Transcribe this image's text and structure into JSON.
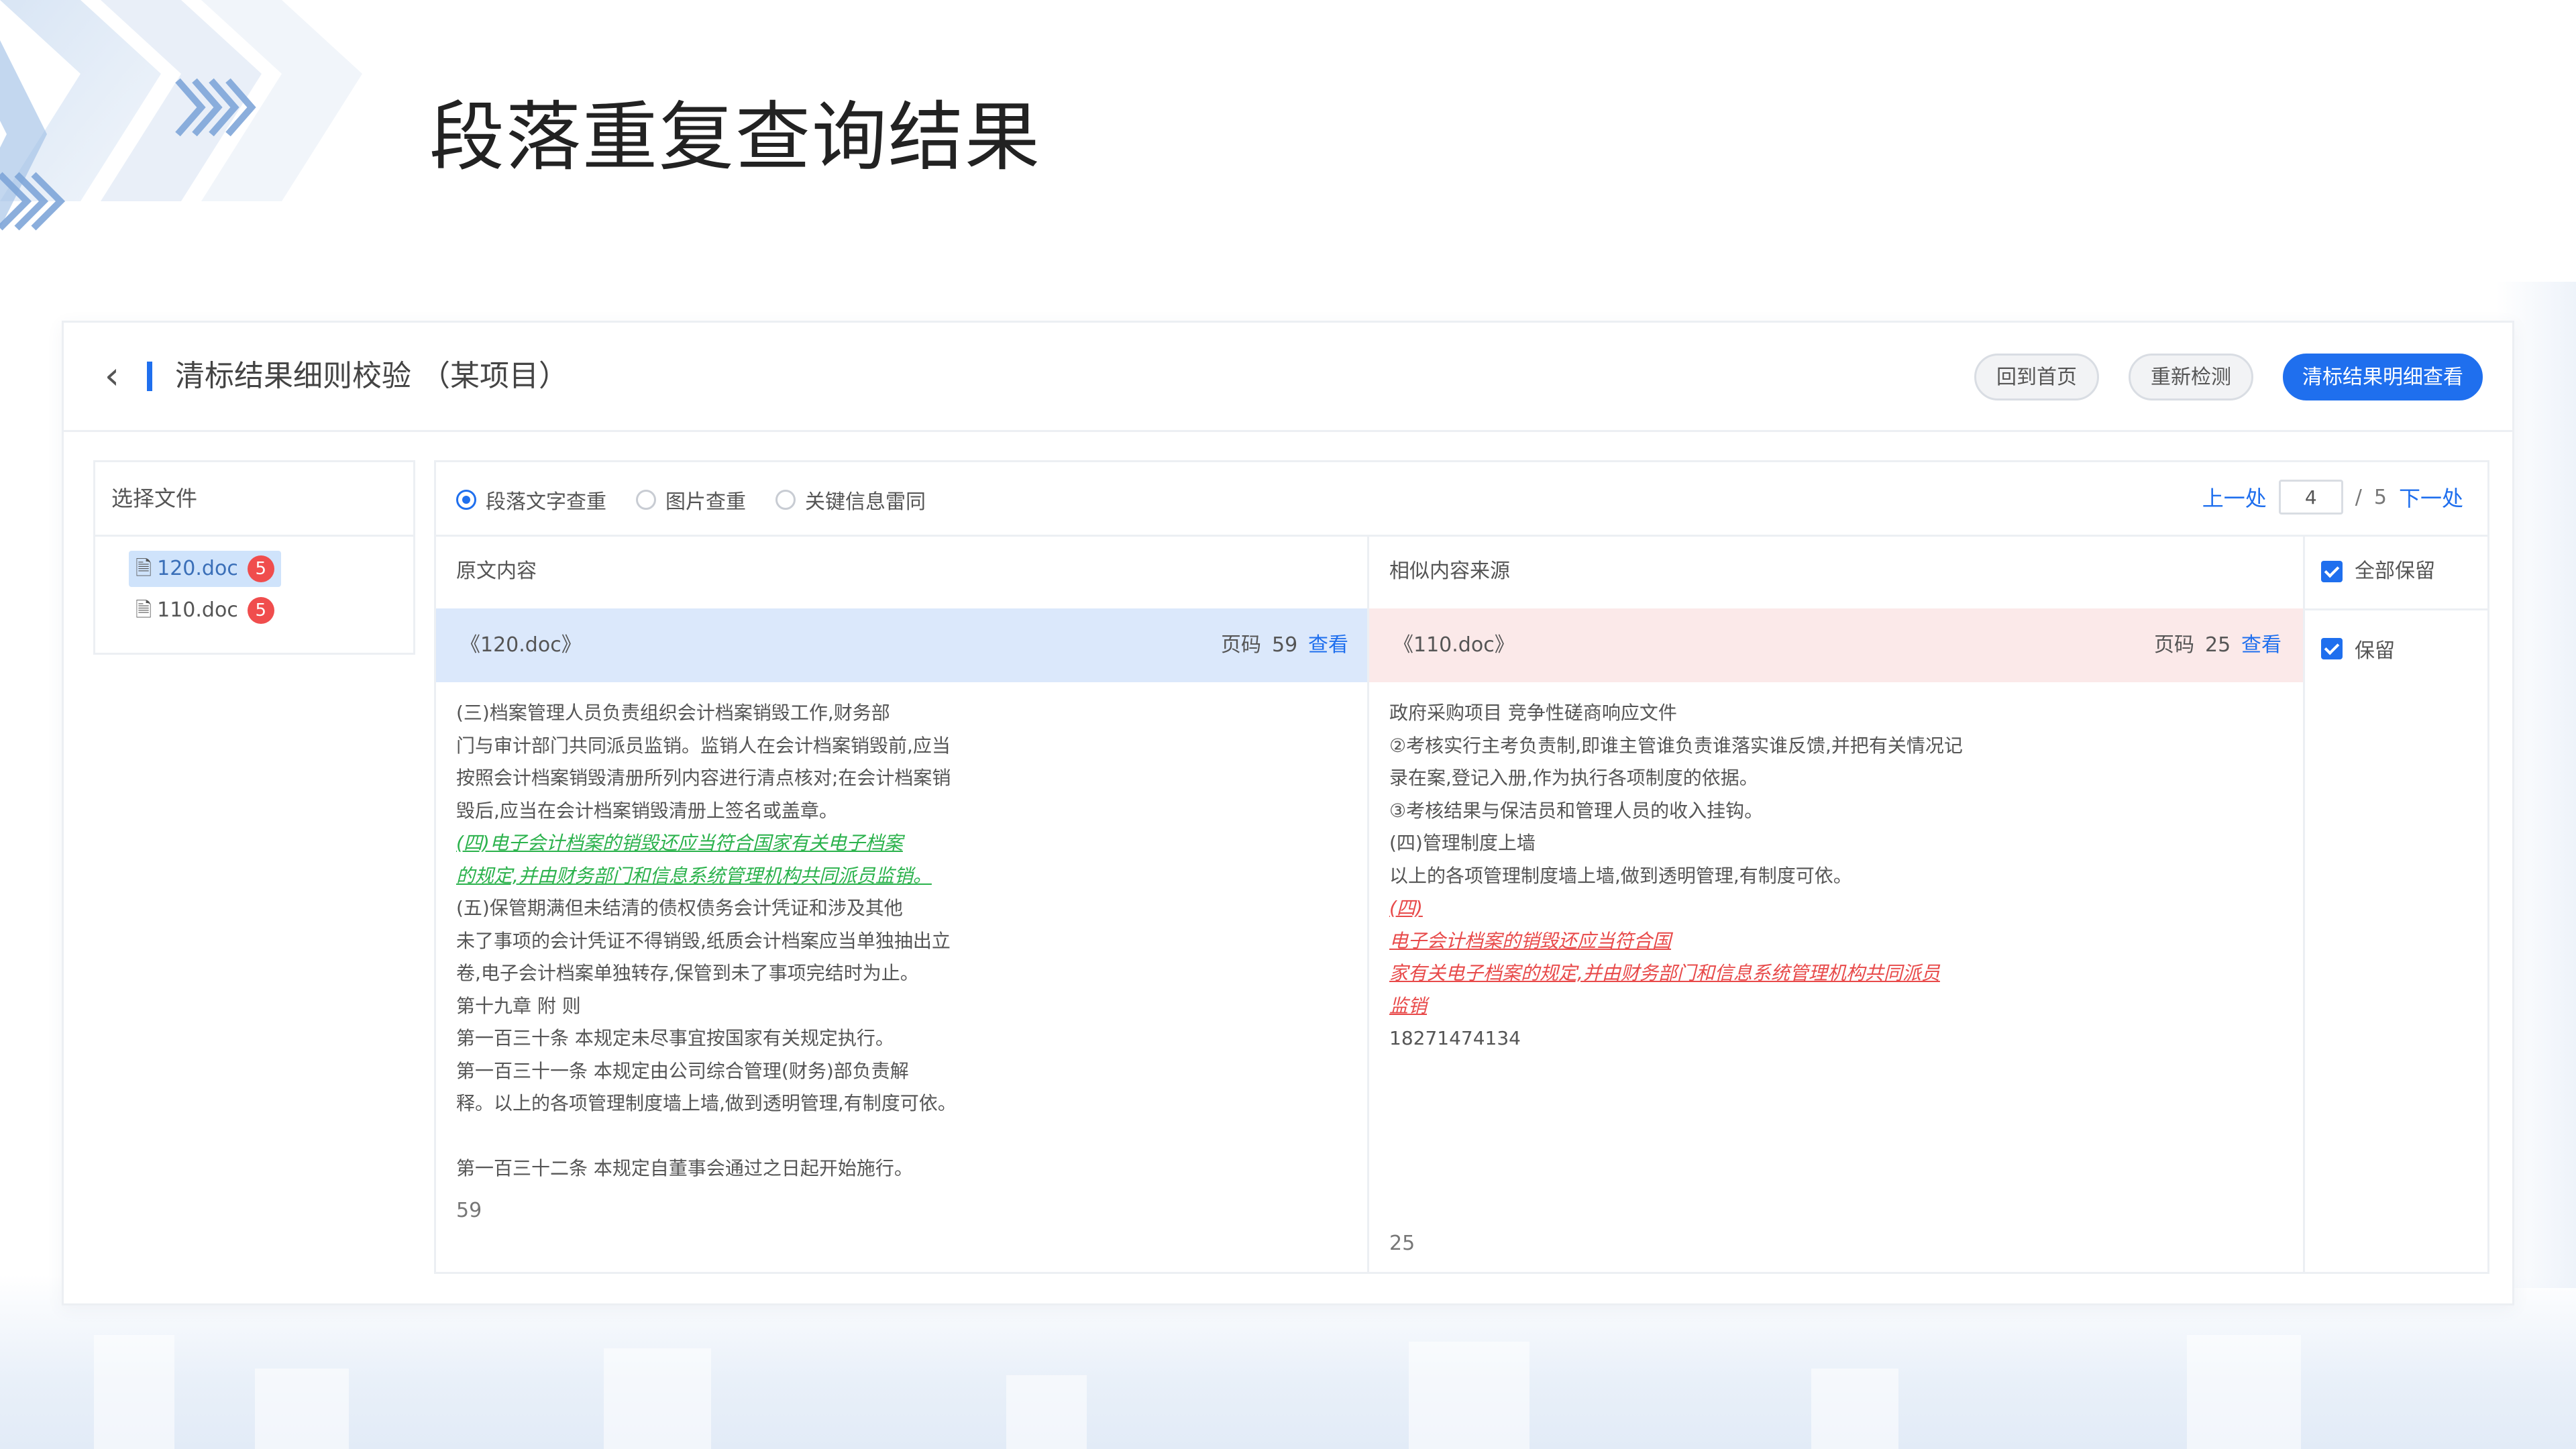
{
  "slide_title": "段落重复查询结果",
  "colors": {
    "accent": "#1f6fee",
    "badge": "#f04d4d",
    "green_highlight": "#2bb24c",
    "red_highlight": "#e84a4a"
  },
  "header": {
    "title": "清标结果细则校验 （某项目）",
    "buttons": {
      "home": "回到首页",
      "recheck": "重新检测",
      "detail": "清标结果明细查看"
    }
  },
  "files": {
    "title": "选择文件",
    "items": [
      {
        "name": "120.doc",
        "count": "5",
        "icon": "document-icon",
        "active": true
      },
      {
        "name": "110.doc",
        "count": "5",
        "icon": "document-icon",
        "active": false
      }
    ]
  },
  "tabs": {
    "options": [
      "段落文字查重",
      "图片查重",
      "关键信息雷同"
    ],
    "selected": "段落文字查重"
  },
  "pager": {
    "prev": "上一处",
    "current": "4",
    "separator": "/",
    "total": "5",
    "next": "下一处"
  },
  "columns": {
    "original": "原文内容",
    "source": "相似内容来源",
    "keep_all": "全部保留"
  },
  "row": {
    "left": {
      "file": "《120.doc》",
      "page_label": "页码",
      "page": "59",
      "view": "查看"
    },
    "right": {
      "file": "《110.doc》",
      "page_label": "页码",
      "page": "25",
      "view": "查看"
    },
    "keep": "保留"
  },
  "left_content": {
    "lines": [
      {
        "text": "(三)档案管理人员负责组织会计档案销毁工作,财务部",
        "hl": false
      },
      {
        "text": "门与审计部门共同派员监销。监销人在会计档案销毁前,应当",
        "hl": false
      },
      {
        "text": "按照会计档案销毁清册所列内容进行清点核对;在会计档案销",
        "hl": false
      },
      {
        "text": "毁后,应当在会计档案销毁清册上签名或盖章。",
        "hl": false
      },
      {
        "text": "(四)电子会计档案的销毁还应当符合国家有关电子档案",
        "hl": true
      },
      {
        "text": "的规定,并由财务部门和信息系统管理机构共同派员监销。",
        "hl": true
      },
      {
        "text": "(五)保管期满但未结清的债权债务会计凭证和涉及其他",
        "hl": false
      },
      {
        "text": "未了事项的会计凭证不得销毁,纸质会计档案应当单独抽出立",
        "hl": false
      },
      {
        "text": "卷,电子会计档案单独转存,保管到未了事项完结时为止。",
        "hl": false
      },
      {
        "text": "第十九章 附 则",
        "hl": false
      },
      {
        "text": "第一百三十条 本规定未尽事宜按国家有关规定执行。",
        "hl": false
      },
      {
        "text": "第一百三十一条 本规定由公司综合管理(财务)部负责解",
        "hl": false
      },
      {
        "text": "释。以上的各项管理制度墙上墙,做到透明管理,有制度可依。",
        "hl": false
      },
      {
        "text": "",
        "hl": false
      },
      {
        "text": "第一百三十二条 本规定自董事会通过之日起开始施行。",
        "hl": false
      }
    ],
    "page": "59"
  },
  "right_content": {
    "lines": [
      {
        "text": "政府采购项目 竞争性磋商响应文件",
        "hl": false
      },
      {
        "text": "②考核实行主考负责制,即谁主管谁负责谁落实谁反馈,并把有关情况记",
        "hl": false
      },
      {
        "text": "录在案,登记入册,作为执行各项制度的依据。",
        "hl": false
      },
      {
        "text": "③考核结果与保洁员和管理人员的收入挂钩。",
        "hl": false
      },
      {
        "text": "(四)管理制度上墙",
        "hl": false
      },
      {
        "text": "以上的各项管理制度墙上墙,做到透明管理,有制度可依。",
        "hl": false
      },
      {
        "text": "(四)",
        "hl": true
      },
      {
        "text": "电子会计档案的销毁还应当符合国",
        "hl": true
      },
      {
        "text": "家有关电子档案的规定,并由财务部门和信息系统管理机构共同派员",
        "hl": true
      },
      {
        "text": "监销",
        "hl": true
      },
      {
        "text": "18271474134",
        "hl": false
      }
    ],
    "page": "25"
  }
}
